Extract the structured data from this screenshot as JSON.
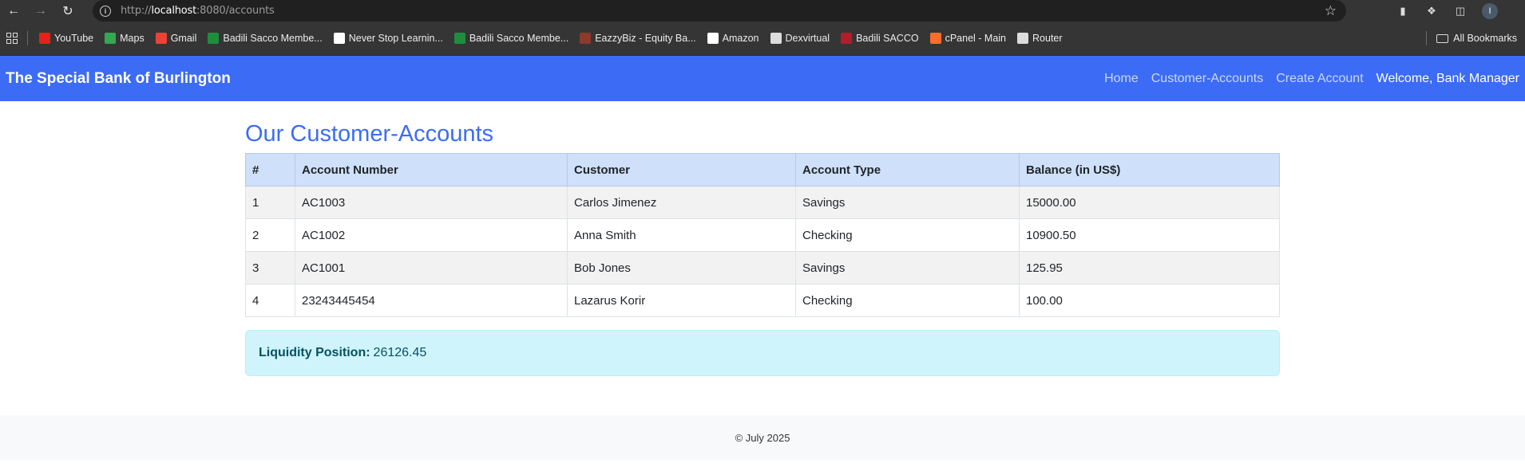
{
  "browser": {
    "url_scheme": "http://",
    "url_host": "localhost",
    "url_rest": ":8080/accounts",
    "bookmarks": [
      {
        "label": "YouTube",
        "icon": "youtube-icon",
        "color": "#e62117"
      },
      {
        "label": "Maps",
        "icon": "maps-icon",
        "color": "#34a853"
      },
      {
        "label": "Gmail",
        "icon": "gmail-icon",
        "color": "#ea4335"
      },
      {
        "label": "Badili Sacco Membe...",
        "icon": "sheets-icon",
        "color": "#1e8e3e"
      },
      {
        "label": "Never Stop Learnin...",
        "icon": "triangle-icon",
        "color": "#ffffff"
      },
      {
        "label": "Badili Sacco Membe...",
        "icon": "sheets-icon",
        "color": "#1e8e3e"
      },
      {
        "label": "EazzyBiz - Equity Ba...",
        "icon": "equity-icon",
        "color": "#8b3a2b"
      },
      {
        "label": "Amazon",
        "icon": "amazon-icon",
        "color": "#ffffff"
      },
      {
        "label": "Dexvirtual",
        "icon": "globe-icon",
        "color": "#dcdcdc"
      },
      {
        "label": "Badili SACCO",
        "icon": "sacco-icon",
        "color": "#b01e2a"
      },
      {
        "label": "cPanel - Main",
        "icon": "cpanel-icon",
        "color": "#ff6c2c"
      },
      {
        "label": "Router",
        "icon": "globe-icon",
        "color": "#dcdcdc"
      }
    ],
    "all_bookmarks": "All Bookmarks",
    "profile_initial": "I"
  },
  "navbar": {
    "brand": "The Special Bank of Burlington",
    "links": [
      "Home",
      "Customer-Accounts",
      "Create Account"
    ],
    "welcome": "Welcome, Bank Manager"
  },
  "main": {
    "title": "Our Customer-Accounts",
    "columns": [
      "#",
      "Account Number",
      "Customer",
      "Account Type",
      "Balance (in US$)"
    ],
    "rows": [
      [
        "1",
        "AC1003",
        "Carlos Jimenez",
        "Savings",
        "15000.00"
      ],
      [
        "2",
        "AC1002",
        "Anna Smith",
        "Checking",
        "10900.50"
      ],
      [
        "3",
        "AC1001",
        "Bob Jones",
        "Savings",
        "125.95"
      ],
      [
        "4",
        "23243445454",
        "Lazarus Korir",
        "Checking",
        "100.00"
      ]
    ],
    "liquidity_label": "Liquidity Position:",
    "liquidity_value": "26126.45"
  },
  "footer": {
    "text": "© July 2025"
  }
}
